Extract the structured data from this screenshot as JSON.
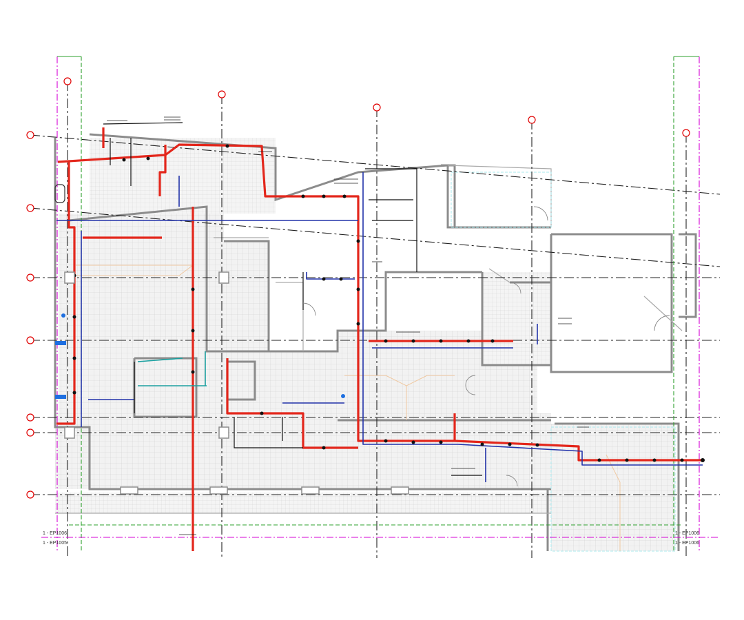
{
  "drawing": {
    "colors": {
      "background": "#ffffff",
      "wall": "#8c8c8c",
      "floor_tile": "#d9d9d9",
      "grid_line": "#222222",
      "grid_bubble": "#e00000",
      "hot_pipe": "#e3261b",
      "cold_pipe": "#2233aa",
      "hvac_cyan": "#1aa0a0",
      "boundary_magenta": "#d400d4",
      "boundary_green": "#2ea02e",
      "fixture_blue": "#1e6fe0"
    },
    "grid_bubbles": {
      "vertical": [
        "",
        "",
        "",
        "",
        ""
      ],
      "horizontal": [
        "",
        "",
        "",
        "",
        "",
        "",
        "",
        ""
      ]
    },
    "match_line_tags": {
      "left_top": "1 - EP1006",
      "left_bottom": "1 - EP1005",
      "right_top": "1 - EP1006",
      "right_bottom": "1 - EP1006"
    }
  }
}
